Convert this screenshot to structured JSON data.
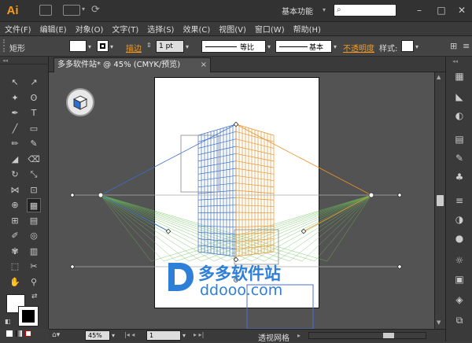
{
  "app": {
    "logo": "Ai",
    "workspace": "基本功能"
  },
  "menu": [
    "文件(F)",
    "编辑(E)",
    "对象(O)",
    "文字(T)",
    "选择(S)",
    "效果(C)",
    "视图(V)",
    "窗口(W)",
    "帮助(H)"
  ],
  "control": {
    "selection_label": "矩形",
    "stroke_label": "描边",
    "stroke_weight": "1 pt",
    "profile_label": "等比",
    "brush_label": "基本",
    "opacity_label": "不透明度",
    "style_label": "样式:"
  },
  "doc_tab": {
    "title": "多多软件站* @ 45% (CMYK/预览)",
    "close": "×"
  },
  "status": {
    "zoom": "45%",
    "page": "1",
    "tool": "透视网格"
  },
  "watermark": {
    "brand": "多多软件站",
    "url": "ddooo.com"
  },
  "colors": {
    "accent": "#f39a1e",
    "grid_left": "#3a6fc8",
    "grid_right": "#e8922a",
    "grid_ground": "#6bbf59",
    "watermark": "#2e7fd8"
  }
}
